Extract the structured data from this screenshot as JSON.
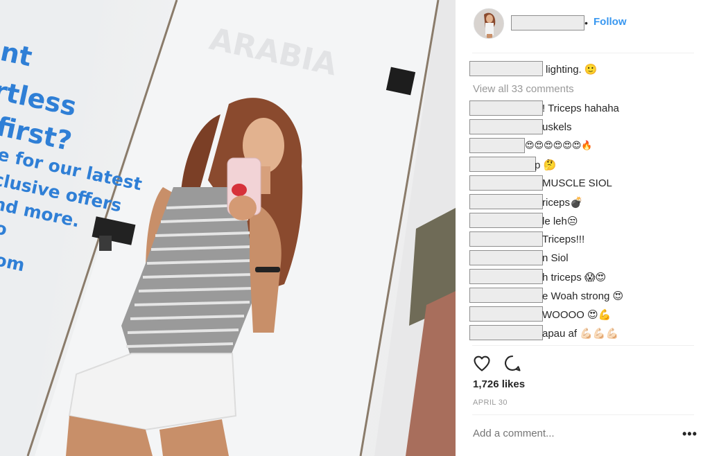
{
  "post": {
    "username_redacted": true,
    "follow_label": "Follow",
    "separator": "•"
  },
  "photo": {
    "wall_text": [
      "nt",
      "rtless",
      "first?",
      "e for our latest",
      "clusive offers",
      "nd more.",
      "o",
      "om"
    ],
    "sign_text": "ARABIA"
  },
  "caption": {
    "text": "lighting. 🙂"
  },
  "view_all": "View all 33 comments",
  "comments": [
    {
      "text": "! Triceps hahaha"
    },
    {
      "text": "uskels"
    },
    {
      "text": "😍😍😍😍😍😍🔥"
    },
    {
      "text": "p 🤔"
    },
    {
      "text": "MUSCLE SIOL"
    },
    {
      "text": "riceps💣"
    },
    {
      "text": "le leh😒"
    },
    {
      "text": "Triceps!!!"
    },
    {
      "text": "n Siol"
    },
    {
      "text": "h triceps 😱😍"
    },
    {
      "text": "e Woah strong 😍"
    },
    {
      "text": "WOOOO 😍💪"
    },
    {
      "text": "apau af 💪🏻💪🏻💪🏻"
    }
  ],
  "likes": "1,726 likes",
  "date": "APRIL 30",
  "add_comment_placeholder": "Add a comment...",
  "more_label": "•••",
  "colors": {
    "link_blue": "#3897f0",
    "muted_grey": "#999999",
    "text_dark": "#262626"
  },
  "icons": [
    "heart-icon",
    "comment-icon",
    "more-icon"
  ]
}
